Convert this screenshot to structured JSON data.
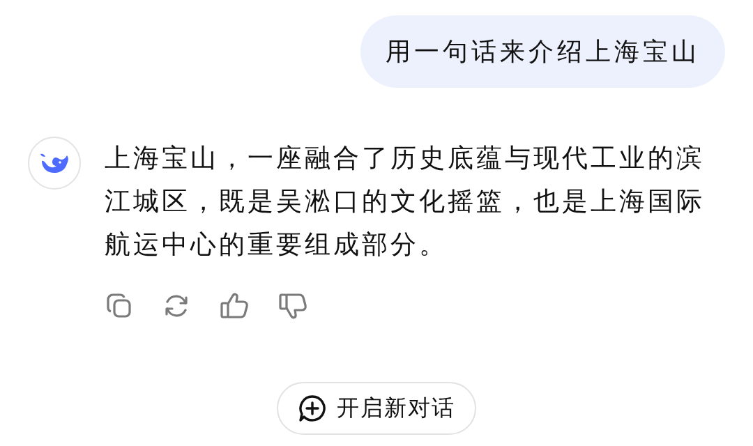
{
  "user_message": {
    "text": "用一句话来介绍上海宝山"
  },
  "assistant_message": {
    "text": "上海宝山，一座融合了历史底蕴与现代工业的滨江城区，既是吴淞口的文化摇篮，也是上海国际航运中心的重要组成部分。"
  },
  "new_chat_button": {
    "label": "开启新对话"
  }
}
